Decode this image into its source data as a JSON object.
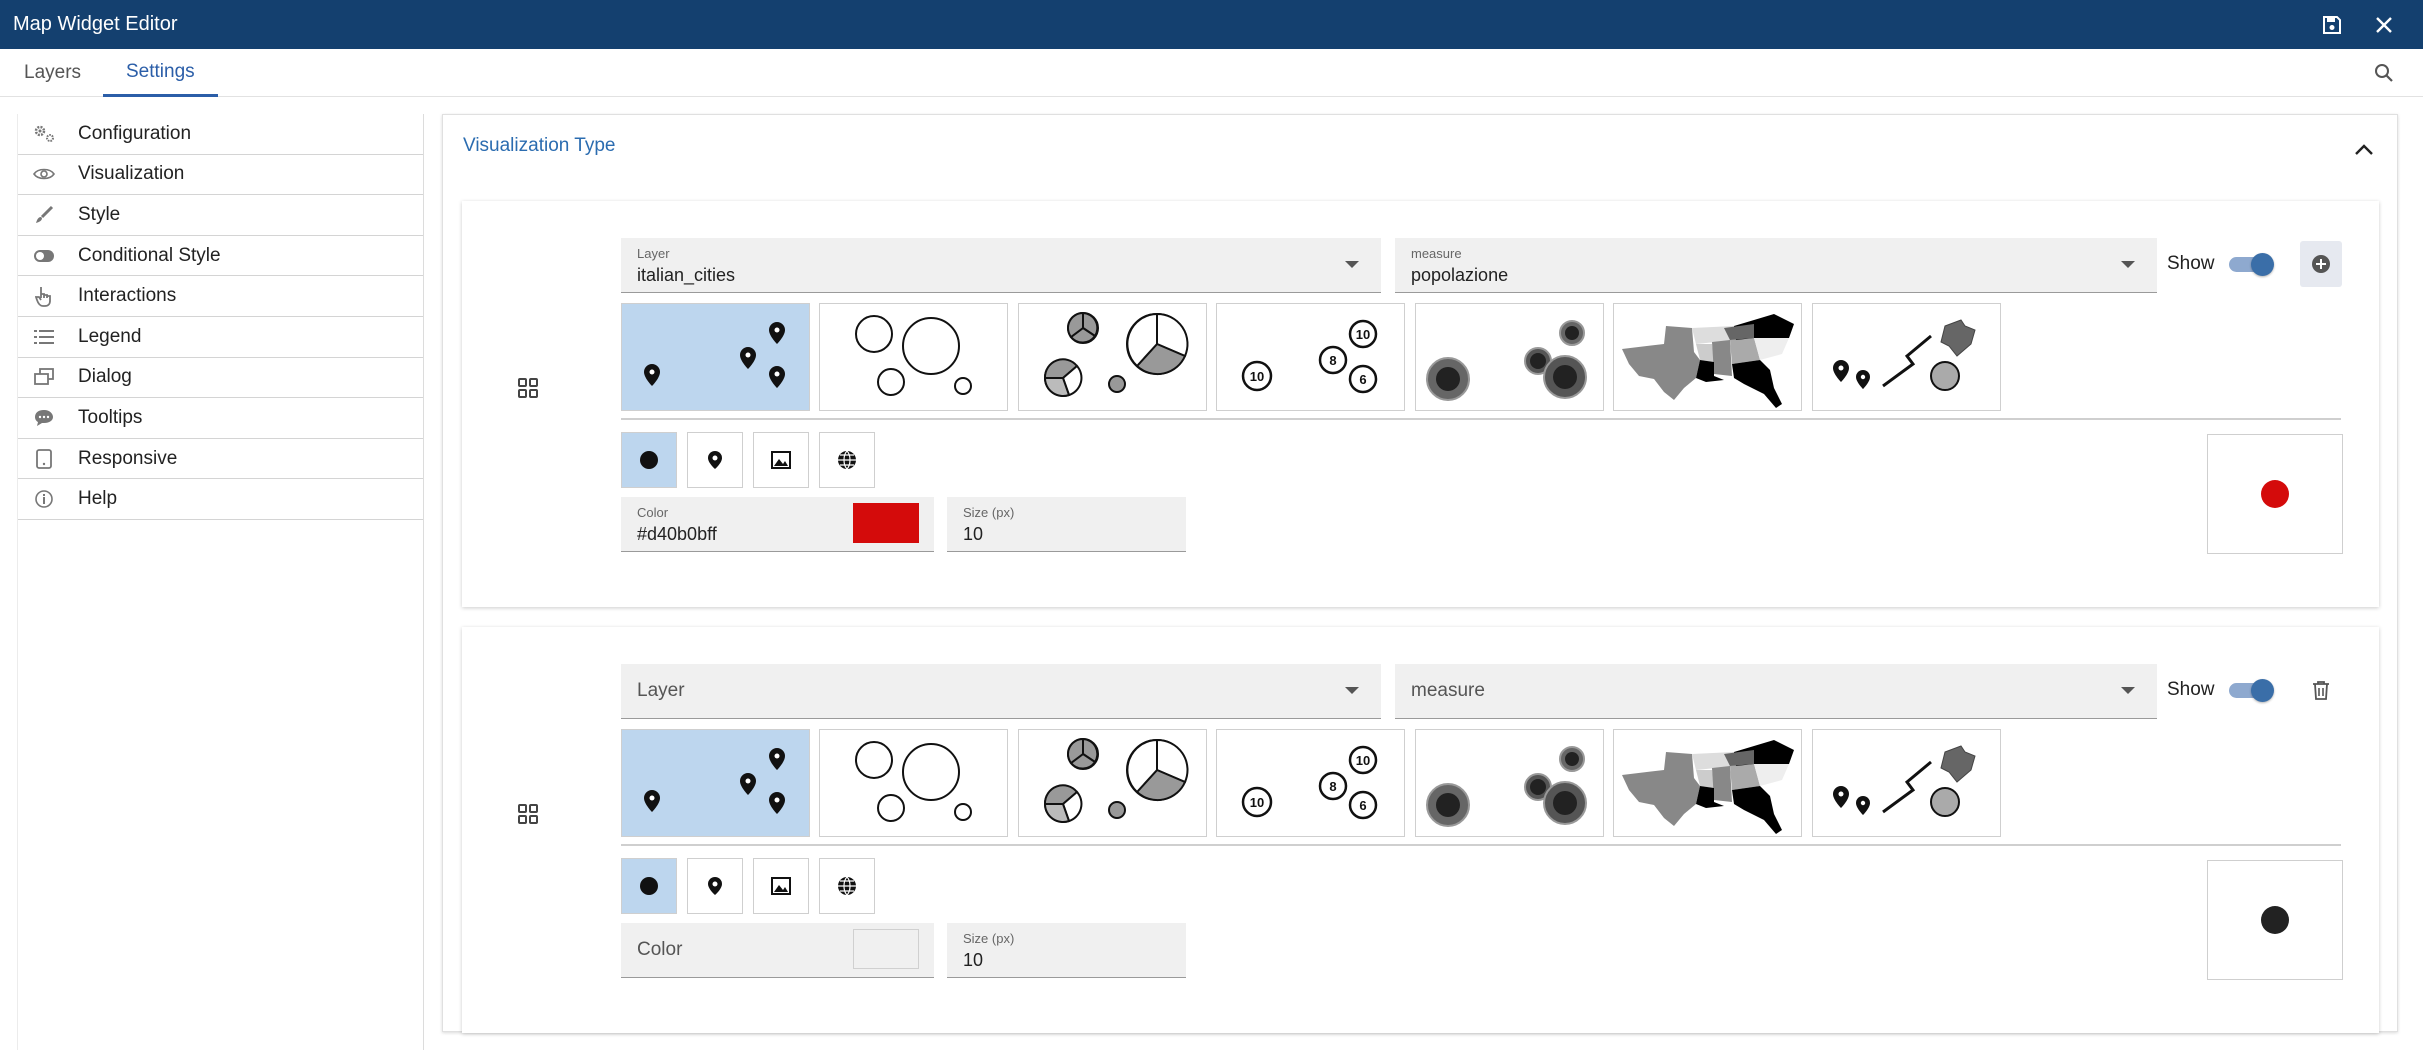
{
  "app": {
    "title": "Map Widget Editor"
  },
  "tabs": [
    {
      "label": "Layers"
    },
    {
      "label": "Settings"
    }
  ],
  "sidebar": {
    "items": [
      {
        "label": "Configuration",
        "icon": "gears-icon"
      },
      {
        "label": "Visualization",
        "icon": "eye-icon"
      },
      {
        "label": "Style",
        "icon": "brush-icon"
      },
      {
        "label": "Conditional Style",
        "icon": "toggle-icon"
      },
      {
        "label": "Interactions",
        "icon": "pointer-hand-icon"
      },
      {
        "label": "Legend",
        "icon": "list-icon"
      },
      {
        "label": "Dialog",
        "icon": "dialog-icon"
      },
      {
        "label": "Tooltips",
        "icon": "chat-bubble-icon"
      },
      {
        "label": "Responsive",
        "icon": "tablet-icon"
      },
      {
        "label": "Help",
        "icon": "info-icon"
      }
    ]
  },
  "section": {
    "title": "Visualization Type"
  },
  "cards": [
    {
      "layer": {
        "label": "Layer",
        "value": "italian_cities"
      },
      "measure": {
        "label": "measure",
        "value": "popolazione"
      },
      "show_label": "Show",
      "show_on": true,
      "action": "add",
      "color": {
        "label": "Color",
        "value": "#d40b0bff",
        "swatch": "#d40b0b"
      },
      "size": {
        "label": "Size (px)",
        "value": "10"
      },
      "preview_color": "#d40b0b"
    },
    {
      "layer": {
        "label": "Layer",
        "value": ""
      },
      "measure": {
        "label": "measure",
        "value": ""
      },
      "show_label": "Show",
      "show_on": true,
      "action": "delete",
      "color": {
        "label": "Color",
        "value": "",
        "swatch": "#f0f0f0"
      },
      "size": {
        "label": "Size (px)",
        "value": "10"
      },
      "preview_color": "#222222"
    }
  ],
  "viz_types": [
    "markers",
    "bubbles",
    "pie-charts",
    "clusters",
    "heatmap",
    "choropleth",
    "geometries"
  ],
  "cluster_labels": [
    "10",
    "8",
    "10",
    "6"
  ],
  "marker_types": [
    "circle-marker-icon",
    "pin-marker-icon",
    "image-marker-icon",
    "web-icon-marker"
  ],
  "colors": {
    "accent": "#2b5ea8",
    "titlebar": "#14406f",
    "selected_tile": "#bdd6ee"
  }
}
